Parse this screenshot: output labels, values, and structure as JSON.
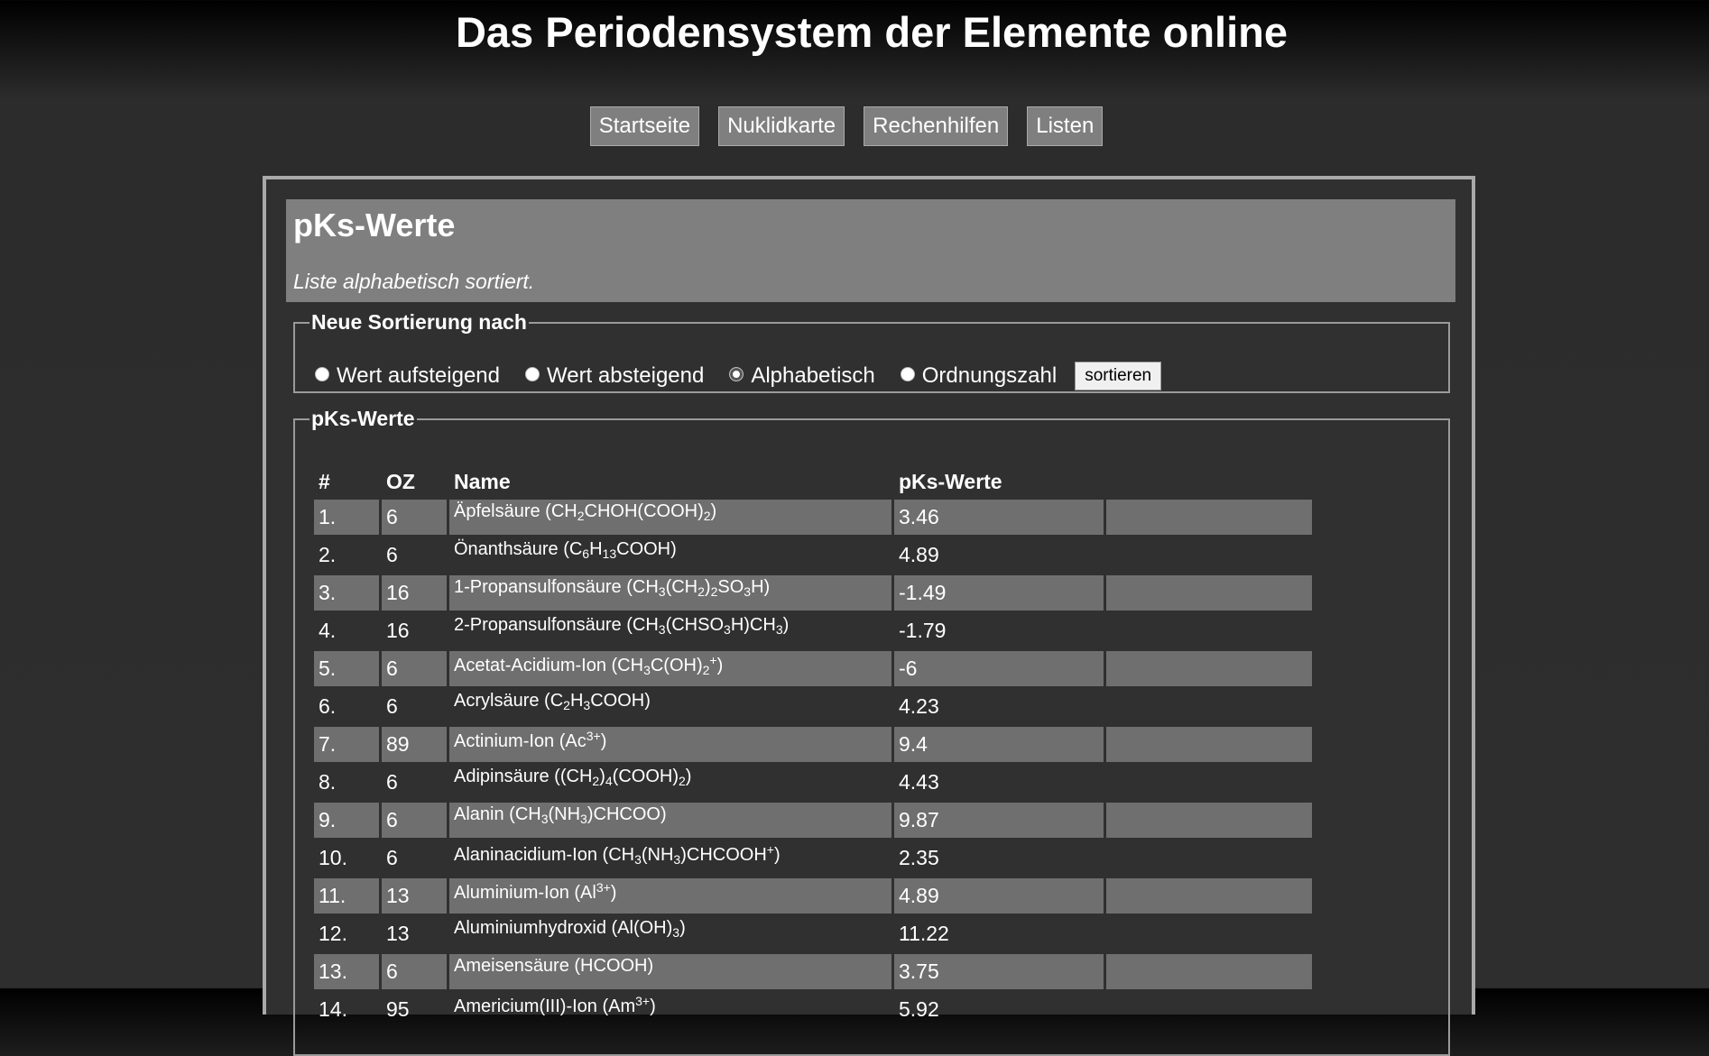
{
  "site": {
    "title": "Das Periodensystem der Elemente online"
  },
  "nav": [
    {
      "label": "Startseite"
    },
    {
      "label": "Nuklidkarte"
    },
    {
      "label": "Rechenhilfen"
    },
    {
      "label": "Listen"
    }
  ],
  "page": {
    "title": "pKs-Werte",
    "subtitle": "Liste alphabetisch sortiert."
  },
  "sort": {
    "legend": "Neue Sortierung nach",
    "options": [
      {
        "label": "Wert aufsteigend",
        "checked": false
      },
      {
        "label": "Wert absteigend",
        "checked": false
      },
      {
        "label": "Alphabetisch",
        "checked": true
      },
      {
        "label": "Ordnungszahl",
        "checked": false
      }
    ],
    "button": "sortieren"
  },
  "table": {
    "legend": "pKs-Werte",
    "headers": [
      "#",
      "OZ",
      "Name",
      "pKs-Werte",
      ""
    ],
    "rows": [
      {
        "num": "1.",
        "oz": "6",
        "name_html": "Äpfelsäure (CH<sub>2</sub>CHOH(COOH)<sub>2</sub>)",
        "value": "3.46"
      },
      {
        "num": "2.",
        "oz": "6",
        "name_html": "Önanthsäure (C<sub>6</sub>H<sub>13</sub>COOH)",
        "value": "4.89"
      },
      {
        "num": "3.",
        "oz": "16",
        "name_html": "1-Propansulfonsäure (CH<sub>3</sub>(CH<sub>2</sub>)<sub>2</sub>SO<sub>3</sub>H)",
        "value": "-1.49"
      },
      {
        "num": "4.",
        "oz": "16",
        "name_html": "2-Propansulfonsäure (CH<sub>3</sub>(CHSO<sub>3</sub>H)CH<sub>3</sub>)",
        "value": "-1.79"
      },
      {
        "num": "5.",
        "oz": "6",
        "name_html": "Acetat-Acidium-Ion (CH<sub>3</sub>C(OH)<sub>2</sub><sup>+</sup>)",
        "value": "-6"
      },
      {
        "num": "6.",
        "oz": "6",
        "name_html": "Acrylsäure (C<sub>2</sub>H<sub>3</sub>COOH)",
        "value": "4.23"
      },
      {
        "num": "7.",
        "oz": "89",
        "name_html": "Actinium-Ion (Ac<sup>3+</sup>)",
        "value": "9.4"
      },
      {
        "num": "8.",
        "oz": "6",
        "name_html": "Adipinsäure ((CH<sub>2</sub>)<sub>4</sub>(COOH)<sub>2</sub>)",
        "value": "4.43"
      },
      {
        "num": "9.",
        "oz": "6",
        "name_html": "Alanin (CH<sub>3</sub>(NH<sub>3</sub>)CHCOO)",
        "value": "9.87"
      },
      {
        "num": "10.",
        "oz": "6",
        "name_html": "Alaninacidium-Ion (CH<sub>3</sub>(NH<sub>3</sub>)CHCOOH<sup>+</sup>)",
        "value": "2.35"
      },
      {
        "num": "11.",
        "oz": "13",
        "name_html": "Aluminium-Ion (Al<sup>3+</sup>)",
        "value": "4.89"
      },
      {
        "num": "12.",
        "oz": "13",
        "name_html": "Aluminiumhydroxid (Al(OH)<sub>3</sub>)",
        "value": "11.22"
      },
      {
        "num": "13.",
        "oz": "6",
        "name_html": "Ameisensäure (HCOOH)",
        "value": "3.75"
      },
      {
        "num": "14.",
        "oz": "95",
        "name_html": "Americium(III)-Ion (Am<sup>3+</sup>)",
        "value": "5.92"
      }
    ]
  }
}
